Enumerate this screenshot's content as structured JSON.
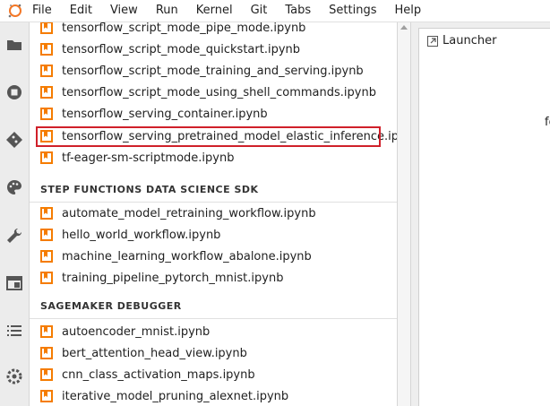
{
  "menubar": {
    "items": [
      "File",
      "Edit",
      "View",
      "Run",
      "Kernel",
      "Git",
      "Tabs",
      "Settings",
      "Help"
    ]
  },
  "rail": {
    "icons": [
      "folder-icon",
      "stop-circle-icon",
      "git-icon",
      "palette-icon",
      "wrench-icon",
      "tab-window-icon",
      "list-icon",
      "extension-icon"
    ]
  },
  "file_browser": {
    "files_top": [
      "tensorflow_script_mode_pipe_mode.ipynb",
      "tensorflow_script_mode_quickstart.ipynb",
      "tensorflow_script_mode_training_and_serving.ipynb",
      "tensorflow_script_mode_using_shell_commands.ipynb",
      "tensorflow_serving_container.ipynb",
      "tensorflow_serving_pretrained_model_elastic_inference.ipynb",
      "tf-eager-sm-scriptmode.ipynb"
    ],
    "section_step_functions": "STEP FUNCTIONS DATA SCIENCE SDK",
    "files_step": [
      "automate_model_retraining_workflow.ipynb",
      "hello_world_workflow.ipynb",
      "machine_learning_workflow_abalone.ipynb",
      "training_pipeline_pytorch_mnist.ipynb"
    ],
    "section_debugger": "SAGEMAKER DEBUGGER",
    "files_debugger": [
      "autoencoder_mnist.ipynb",
      "bert_attention_head_view.ipynb",
      "cnn_class_activation_maps.ipynb",
      "iterative_model_pruning_alexnet.ipynb"
    ],
    "selected_file": "tensorflow_serving_pretrained_model_elastic_inference.ipynb"
  },
  "main": {
    "tab_label": "Launcher",
    "body_text_fragment": "fo"
  },
  "colors": {
    "notebook_icon": "#f57c00",
    "highlight_border": "#d0202a",
    "rail_bg": "#ececec"
  }
}
